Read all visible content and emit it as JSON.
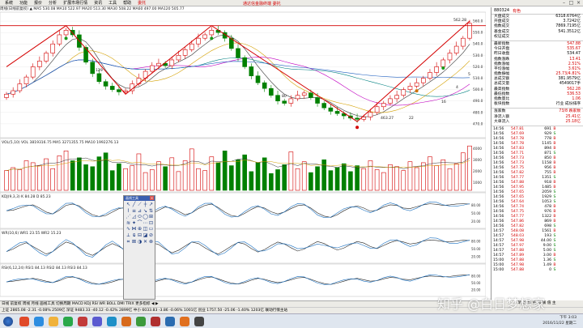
{
  "app": {
    "menus": [
      "系统",
      "功能",
      "报价",
      "分析",
      "扩展市场行情",
      "资讯",
      "工具",
      "帮助"
    ],
    "highlight_menu": "委托",
    "title": "通达信金融终端 委托"
  },
  "info_line": "周线(日线前复权)  ▲  MA5 530.08  MA10 522.97  MA20 513.30  MA30 508.22  MA60 497.00  MA120 505.77",
  "chart_labels": {
    "high_mark": "562.28",
    "low_mark": "463.27",
    "vol_header": "VOL(5,10)  VOL 3819316.75  MA5 3271355.75  MA10 1992276.13",
    "kdj_header": "KDJ(9,3,3)  K 84.28  D 85.23",
    "wr_header": "WR(10,6)  WR1 23.55  WR2 15.23",
    "rsi_header": "RSI(6,12,24)  RSI1 84.13  RSI2 84.13  RSI3 84.13",
    "annot_1": "129",
    "annot_2": "80",
    "annot_3": "22",
    "annot_4": "16",
    "annot_5": "4",
    "annot_6": "5",
    "x_axis": [
      "2014",
      "2015",
      "",
      "",
      "",
      "",
      "",
      "",
      "",
      "",
      "",
      "",
      "",
      "",
      "",
      "",
      "",
      "",
      "10",
      "",
      "",
      "",
      "",
      "",
      "11",
      "12"
    ],
    "price_ticks": [
      "560.0",
      "550.0",
      "540.0",
      "530.0",
      "520.0",
      "510.0",
      "500.0",
      "490.0",
      "480.0",
      "470.0"
    ],
    "vol_ticks": [
      "4000",
      "3000",
      "2000",
      "1000"
    ],
    "osc_ticks": [
      "80.00",
      "50.00",
      "20.00"
    ]
  },
  "chart_data": {
    "type": "line",
    "x": [
      0,
      1,
      2,
      3,
      4,
      5,
      6,
      7,
      8,
      9,
      10,
      11,
      12,
      13,
      14,
      15,
      16,
      17,
      18,
      19,
      20,
      21,
      22,
      23,
      24,
      25,
      26,
      27,
      28,
      29,
      30,
      31,
      32,
      33,
      34,
      35,
      36,
      37,
      38,
      39,
      40,
      41,
      42,
      43,
      44,
      45,
      46,
      47,
      48,
      49,
      50,
      51,
      52,
      53,
      54,
      55,
      56,
      57,
      58,
      59,
      60,
      61,
      62,
      63,
      64,
      65,
      66,
      67,
      68,
      69,
      70
    ],
    "series": [
      {
        "name": "close",
        "values": [
          496,
          499,
          505,
          511,
          520,
          525,
          532,
          540,
          548,
          552,
          548,
          537,
          524,
          514,
          507,
          503,
          500,
          498,
          499,
          505,
          510,
          516,
          521,
          523,
          521,
          526,
          530,
          535,
          540,
          545,
          548,
          552,
          550,
          545,
          536,
          528,
          520,
          512,
          506,
          501,
          495,
          490,
          488,
          492,
          495,
          497,
          493,
          488,
          484,
          481,
          479,
          477,
          475,
          474,
          476,
          480,
          485,
          488,
          492,
          495,
          500,
          503,
          506,
          510,
          515,
          520,
          526,
          532,
          538,
          545,
          558
        ]
      },
      {
        "name": "volume",
        "values": [
          20,
          23,
          21,
          30,
          28,
          25,
          32,
          22,
          35,
          40,
          30,
          33,
          26,
          24,
          34,
          38,
          20,
          27,
          22,
          25,
          37,
          18,
          21,
          29,
          24,
          33,
          19,
          30,
          42,
          22,
          20,
          34,
          28,
          40,
          25,
          31,
          36,
          19,
          28,
          33,
          17,
          21,
          26,
          39,
          22,
          29,
          18,
          24,
          31,
          20,
          23,
          27,
          19,
          25,
          22,
          30,
          21,
          18,
          26,
          24,
          20,
          29,
          23,
          28,
          34,
          25,
          31,
          22,
          27,
          38,
          45
        ]
      },
      {
        "name": "kdj",
        "values": [
          60,
          62,
          70,
          78,
          82,
          70,
          55,
          48,
          62,
          80,
          85,
          78,
          60,
          45,
          38,
          42,
          55,
          68,
          72,
          65,
          50,
          40,
          48,
          62,
          74,
          70,
          58,
          45,
          52,
          68,
          80,
          85,
          72,
          55,
          42,
          38,
          50,
          65,
          76,
          70,
          56,
          48,
          55,
          68,
          79,
          82,
          70,
          52,
          40,
          35,
          45,
          60,
          72,
          78,
          70,
          58,
          62,
          74,
          82,
          80,
          70,
          68,
          75,
          82,
          86,
          84,
          80,
          82,
          85,
          86,
          85
        ]
      },
      {
        "name": "wr",
        "values": [
          40,
          50,
          65,
          75,
          60,
          45,
          30,
          40,
          60,
          78,
          70,
          55,
          35,
          25,
          40,
          58,
          72,
          60,
          45,
          30,
          42,
          60,
          75,
          68,
          50,
          35,
          45,
          62,
          78,
          72,
          55,
          40,
          30,
          45,
          62,
          76,
          70,
          52,
          38,
          48,
          64,
          78,
          70,
          55,
          42,
          50,
          66,
          80,
          72,
          58,
          46,
          54,
          68,
          80,
          74,
          60,
          52,
          64,
          76,
          84,
          78,
          70,
          74,
          82,
          86,
          84,
          80,
          78,
          82,
          85,
          84
        ]
      },
      {
        "name": "rsi",
        "values": [
          55,
          58,
          62,
          66,
          70,
          65,
          58,
          52,
          60,
          72,
          76,
          70,
          60,
          50,
          45,
          48,
          55,
          64,
          68,
          62,
          54,
          48,
          52,
          60,
          68,
          66,
          58,
          50,
          54,
          64,
          72,
          76,
          68,
          58,
          50,
          46,
          52,
          62,
          70,
          66,
          58,
          52,
          56,
          64,
          72,
          74,
          66,
          56,
          48,
          44,
          50,
          58,
          66,
          70,
          64,
          58,
          60,
          68,
          74,
          72,
          66,
          64,
          70,
          76,
          80,
          78,
          76,
          78,
          82,
          84,
          84
        ]
      }
    ],
    "ylim": [
      460,
      565
    ]
  },
  "sidebar": {
    "code": "880324",
    "name": "有色",
    "quote_rows": [
      {
        "k": "大盘成交",
        "v": "6318.6764亿",
        "c": ""
      },
      {
        "k": "开盘成交",
        "v": "3.7242亿",
        "c": ""
      },
      {
        "k": "指数成交",
        "v": "7869.7195亿",
        "c": ""
      },
      {
        "k": "基金成交",
        "v": "541.3512亿",
        "c": ""
      },
      {
        "k": "权证成交",
        "v": "",
        "c": ""
      }
    ],
    "price_rows": [
      {
        "k": "最新指数",
        "v": "547.88",
        "c": "red"
      },
      {
        "k": "今日开盘",
        "v": "535.67",
        "c": "red"
      },
      {
        "k": "昨日收盘",
        "v": "534.47",
        "c": ""
      },
      {
        "k": "指数涨跌",
        "v": "13.41",
        "c": "red"
      },
      {
        "k": "指数涨幅",
        "v": "2.51%",
        "c": "red"
      },
      {
        "k": "平均涨幅",
        "v": "3.61%",
        "c": "red"
      },
      {
        "k": "指数振幅",
        "v": "25.73/4.81%",
        "c": "red"
      },
      {
        "k": "总成交额",
        "v": "381.9579亿",
        "c": ""
      },
      {
        "k": "总成交量",
        "v": "4549017手",
        "c": ""
      },
      {
        "k": "最高指数",
        "v": "562.28",
        "c": "red"
      },
      {
        "k": "最低指数",
        "v": "536.53",
        "c": "red"
      },
      {
        "k": "指数量比",
        "v": "1.06",
        "c": "red"
      },
      {
        "k": "板块指数",
        "v": "行业 成份排序",
        "c": ""
      }
    ],
    "stats_rows": [
      {
        "k": "涨家数",
        "v": "73/8 跌家数",
        "c": "red"
      },
      {
        "k": "净流入额",
        "v": "25.41亿",
        "c": "red"
      },
      {
        "k": "大单流入",
        "v": "25.18亿",
        "c": "red"
      }
    ],
    "ticks": [
      {
        "t": "14:56",
        "p": "547.81",
        "v": "691",
        "d": "B"
      },
      {
        "t": "14:56",
        "p": "547.69",
        "v": "929",
        "d": "S"
      },
      {
        "t": "14:56",
        "p": "547.78",
        "v": "778",
        "d": "B"
      },
      {
        "t": "14:56",
        "p": "547.78",
        "v": "1145",
        "d": "B"
      },
      {
        "t": "14:56",
        "p": "547.83",
        "v": "894",
        "d": "B"
      },
      {
        "t": "14:56",
        "p": "547.71",
        "v": "871",
        "d": "S"
      },
      {
        "t": "14:56",
        "p": "547.73",
        "v": "850",
        "d": "B"
      },
      {
        "t": "14:56",
        "p": "547.73",
        "v": "1158",
        "d": "B"
      },
      {
        "t": "14:56",
        "p": "547.75",
        "v": "956",
        "d": "B"
      },
      {
        "t": "14:56",
        "p": "547.82",
        "v": "755",
        "d": "B"
      },
      {
        "t": "14:56",
        "p": "547.77",
        "v": "1351",
        "d": "S"
      },
      {
        "t": "14:56",
        "p": "547.88",
        "v": "918",
        "d": "B"
      },
      {
        "t": "14:56",
        "p": "547.95",
        "v": "1485",
        "d": "B"
      },
      {
        "t": "14:56",
        "p": "547.65",
        "v": "2059",
        "d": "S"
      },
      {
        "t": "14:56",
        "p": "547.65",
        "v": "1929",
        "d": "S"
      },
      {
        "t": "14:56",
        "p": "547.64",
        "v": "1053",
        "d": "S"
      },
      {
        "t": "14:56",
        "p": "547.74",
        "v": "478",
        "d": "B"
      },
      {
        "t": "14:56",
        "p": "547.75",
        "v": "976",
        "d": "B"
      },
      {
        "t": "14:56",
        "p": "547.77",
        "v": "1322",
        "d": "B"
      },
      {
        "t": "14:56",
        "p": "547.86",
        "v": "869",
        "d": "B"
      },
      {
        "t": "14:56",
        "p": "547.82",
        "v": "698",
        "d": "S"
      },
      {
        "t": "14:57",
        "p": "548.08",
        "v": "1561",
        "d": "B"
      },
      {
        "t": "14:57",
        "p": "548.03",
        "v": "193",
        "d": "S"
      },
      {
        "t": "14:57",
        "p": "547.98",
        "v": "44.00",
        "d": "S"
      },
      {
        "t": "14:57",
        "p": "547.97",
        "v": "9.00",
        "d": "S"
      },
      {
        "t": "14:57",
        "p": "547.88",
        "v": "5.00",
        "d": "S"
      },
      {
        "t": "14:57",
        "p": "547.89",
        "v": "3.00",
        "d": "B"
      },
      {
        "t": "15:00",
        "p": "547.88",
        "v": "1.36",
        "d": "S"
      },
      {
        "t": "15:00",
        "p": "547.98",
        "v": "1.49",
        "d": "B"
      },
      {
        "t": "15:00",
        "p": "547.88",
        "v": "0",
        "d": "S"
      }
    ],
    "period_tabs": "笔 价 细 势 指 联 值 主"
  },
  "toolbox": {
    "title": "画线工具",
    "close": "×"
  },
  "status_bar1": "日线  前复权  周线  月线  画线工具  切换周期  MACD  KDJ  RSI  WR  BOLL  DMI  TRIX  更多指标  ◀ ▶",
  "status_bar2": "上证 2865.08  -2.31  -0.08%  2509亿   深证 9483.33  -40.12  -0.42%  2899亿   中小 6033.83  -3.86  -0.06%  1001亿   创业 1757.50  -25.06  -1.40%  1203亿   联动行情主站",
  "clock": {
    "time": "下午 3:03",
    "date": "2016/11/22 星期二"
  },
  "watermark": "知乎 @白日梦想家"
}
